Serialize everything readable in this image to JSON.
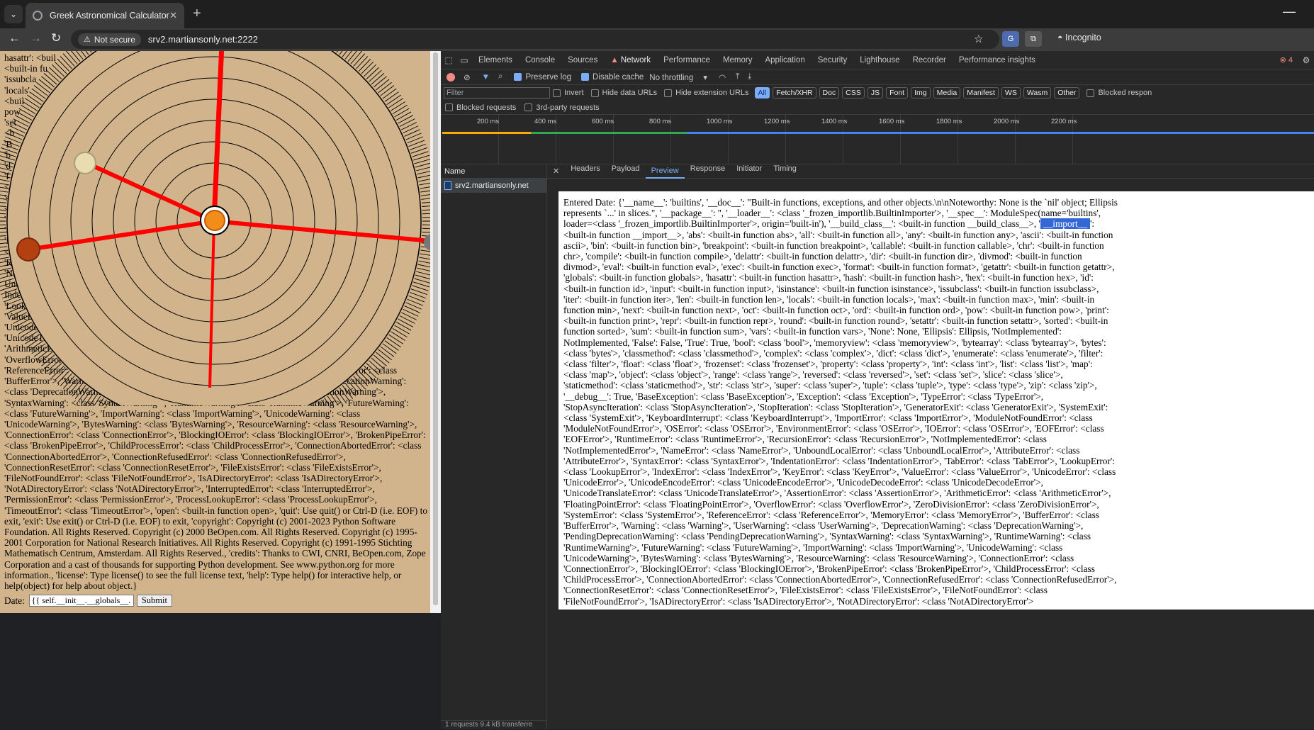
{
  "browser": {
    "tab_title": "Greek Astronomical Calculator",
    "security_label": "Not secure",
    "url": "srv2.martiansonly.net:2222",
    "profile_label": "Incognito"
  },
  "page": {
    "overlay_lines": [
      "hasattr': <buil",
      "<built-in fu",
      "'issubcla",
      "'locals'",
      "<buil",
      "pow",
      "'set",
      "<b",
      "'B",
      "'b",
      "'d",
      "'f",
      "<",
      "'s",
      "<",
      "'Sto",
      "'Sys",
      "'Mod",
      "<class",
      "'Runtim",
      "'NotImple",
      "UnboundL",
      "IndentationEr",
      "'LookupError'>,",
      "'ValueError'>, 'Uni",
      "'UnicodeDecodeError",
      "'UnicodeTranslateError'>,",
      "'ArithmeticError'>, 'FloatingPo",
      "'OverflowError'>, 'ZeroDivisionError",
      "'ReferenceError': <class 'ReferenceError'>, 'MemoryError': <class 'MemoryError'>, 'BufferError': <class"
    ],
    "text": "'BufferError'>, 'Warning': <class 'Warning'>, 'UserWarning': <class 'UserWarning'>, 'DeprecationWarning': <class 'DeprecationWarning'>, 'PendingDeprecationWarning': <class 'PendingDeprecationWarning'>, 'SyntaxWarning': <class 'SyntaxWarning'>, 'RuntimeWarning': <class 'RuntimeWarning'>, 'FutureWarning': <class 'FutureWarning'>, 'ImportWarning': <class 'ImportWarning'>, 'UnicodeWarning': <class 'UnicodeWarning'>, 'BytesWarning': <class 'BytesWarning'>, 'ResourceWarning': <class 'ResourceWarning'>, 'ConnectionError': <class 'ConnectionError'>, 'BlockingIOError': <class 'BlockingIOError'>, 'BrokenPipeError': <class 'BrokenPipeError'>, 'ChildProcessError': <class 'ChildProcessError'>, 'ConnectionAbortedError': <class 'ConnectionAbortedError'>, 'ConnectionRefusedError': <class 'ConnectionRefusedError'>, 'ConnectionResetError': <class 'ConnectionResetError'>, 'FileExistsError': <class 'FileExistsError'>, 'FileNotFoundError': <class 'FileNotFoundError'>, 'IsADirectoryError': <class 'IsADirectoryError'>, 'NotADirectoryError': <class 'NotADirectoryError'>, 'InterruptedError': <class 'InterruptedError'>, 'PermissionError': <class 'PermissionError'>, 'ProcessLookupError': <class 'ProcessLookupError'>, 'TimeoutError': <class 'TimeoutError'>, 'open': <built-in function open>, 'quit': Use quit() or Ctrl-D (i.e. EOF) to exit, 'exit': Use exit() or Ctrl-D (i.e. EOF) to exit, 'copyright': Copyright (c) 2001-2023 Python Software Foundation. All Rights Reserved. Copyright (c) 2000 BeOpen.com. All Rights Reserved. Copyright (c) 1995-2001 Corporation for National Research Initiatives. All Rights Reserved. Copyright (c) 1991-1995 Stichting Mathematisch Centrum, Amsterdam. All Rights Reserved., 'credits': Thanks to CWI, CNRI, BeOpen.com, Zope Corporation and a cast of thousands for supporting Python development. See www.python.org for more information., 'license': Type license() to see the full license text, 'help': Type help() for interactive help, or help(object) for help about object.}",
    "date_label": "Date:",
    "date_value": "{{ self.__init__.__globals__.",
    "submit_label": "Submit"
  },
  "devtools": {
    "tabs": [
      "Elements",
      "Console",
      "Sources",
      "Network",
      "Performance",
      "Memory",
      "Application",
      "Security",
      "Lighthouse",
      "Recorder",
      "Performance insights"
    ],
    "error_count": "4",
    "preserve_log": "Preserve log",
    "disable_cache": "Disable cache",
    "throttling": "No throttling",
    "filter_placeholder": "Filter",
    "invert": "Invert",
    "hide_data_urls": "Hide data URLs",
    "hide_ext_urls": "Hide extension URLs",
    "type_filters": [
      "All",
      "Fetch/XHR",
      "Doc",
      "CSS",
      "JS",
      "Font",
      "Img",
      "Media",
      "Manifest",
      "WS",
      "Wasm",
      "Other"
    ],
    "blocked_resp": "Blocked respon",
    "blocked_requests": "Blocked requests",
    "third_party": "3rd-party requests",
    "ticks": [
      "200 ms",
      "400 ms",
      "600 ms",
      "800 ms",
      "1000 ms",
      "1200 ms",
      "1400 ms",
      "1600 ms",
      "1800 ms",
      "2000 ms",
      "2200 ms"
    ],
    "name_header": "Name",
    "request_name": "srv2.martiansonly.net",
    "status": "1 requests   9.4 kB transferre",
    "detail_tabs": [
      "Headers",
      "Payload",
      "Preview",
      "Response",
      "Initiator",
      "Timing"
    ],
    "preview_before": "Entered Date: {'__name__': 'builtins', '__doc__': \"Built-in functions, exceptions, and other objects.\\n\\nNoteworthy: None is the `nil' object; Ellipsis represents `...' in slices.\", '__package__': '', '__loader__': <class '_frozen_importlib.BuiltinImporter'>, '__spec__': ModuleSpec(name='builtins', loader=<class '_frozen_importlib.BuiltinImporter'>, origin='built-in'), '__build_class__': <built-in function __build_class__>, '",
    "preview_highlight": "__import__",
    "preview_after": "': <built-in function __import__>, 'abs': <built-in function abs>, 'all': <built-in function all>, 'any': <built-in function any>, 'ascii': <built-in function ascii>, 'bin': <built-in function bin>, 'breakpoint': <built-in function breakpoint>, 'callable': <built-in function callable>, 'chr': <built-in function chr>, 'compile': <built-in function compile>, 'delattr': <built-in function delattr>, 'dir': <built-in function dir>, 'divmod': <built-in function divmod>, 'eval': <built-in function eval>, 'exec': <built-in function exec>, 'format': <built-in function format>, 'getattr': <built-in function getattr>, 'globals': <built-in function globals>, 'hasattr': <built-in function hasattr>, 'hash': <built-in function hash>, 'hex': <built-in function hex>, 'id': <built-in function id>, 'input': <built-in function input>, 'isinstance': <built-in function isinstance>, 'issubclass': <built-in function issubclass>, 'iter': <built-in function iter>, 'len': <built-in function len>, 'locals': <built-in function locals>, 'max': <built-in function max>, 'min': <built-in function min>, 'next': <built-in function next>, 'oct': <built-in function oct>, 'ord': <built-in function ord>, 'pow': <built-in function pow>, 'print': <built-in function print>, 'repr': <built-in function repr>, 'round': <built-in function round>, 'setattr': <built-in function setattr>, 'sorted': <built-in function sorted>, 'sum': <built-in function sum>, 'vars': <built-in function vars>, 'None': None, 'Ellipsis': Ellipsis, 'NotImplemented': NotImplemented, 'False': False, 'True': True, 'bool': <class 'bool'>, 'memoryview': <class 'memoryview'>, 'bytearray': <class 'bytearray'>, 'bytes': <class 'bytes'>, 'classmethod': <class 'classmethod'>, 'complex': <class 'complex'>, 'dict': <class 'dict'>, 'enumerate': <class 'enumerate'>, 'filter': <class 'filter'>, 'float': <class 'float'>, 'frozenset': <class 'frozenset'>, 'property': <class 'property'>, 'int': <class 'int'>, 'list': <class 'list'>, 'map': <class 'map'>, 'object': <class 'object'>, 'range': <class 'range'>, 'reversed': <class 'reversed'>, 'set': <class 'set'>, 'slice': <class 'slice'>, 'staticmethod': <class 'staticmethod'>, 'str': <class 'str'>, 'super': <class 'super'>, 'tuple': <class 'tuple'>, 'type': <class 'type'>, 'zip': <class 'zip'>, '__debug__': True, 'BaseException': <class 'BaseException'>, 'Exception': <class 'Exception'>, 'TypeError': <class 'TypeError'>, 'StopAsyncIteration': <class 'StopAsyncIteration'>, 'StopIteration': <class 'StopIteration'>, 'GeneratorExit': <class 'GeneratorExit'>, 'SystemExit': <class 'SystemExit'>, 'KeyboardInterrupt': <class 'KeyboardInterrupt'>, 'ImportError': <class 'ImportError'>, 'ModuleNotFoundError': <class 'ModuleNotFoundError'>, 'OSError': <class 'OSError'>, 'EnvironmentError': <class 'OSError'>, 'IOError': <class 'OSError'>, 'EOFError': <class 'EOFError'>, 'RuntimeError': <class 'RuntimeError'>, 'RecursionError': <class 'RecursionError'>, 'NotImplementedError': <class 'NotImplementedError'>, 'NameError': <class 'NameError'>, 'UnboundLocalError': <class 'UnboundLocalError'>, 'AttributeError': <class 'AttributeError'>, 'SyntaxError': <class 'SyntaxError'>, 'IndentationError': <class 'IndentationError'>, 'TabError': <class 'TabError'>, 'LookupError': <class 'LookupError'>, 'IndexError': <class 'IndexError'>, 'KeyError': <class 'KeyError'>, 'ValueError': <class 'ValueError'>, 'UnicodeError': <class 'UnicodeError'>, 'UnicodeEncodeError': <class 'UnicodeEncodeError'>, 'UnicodeDecodeError': <class 'UnicodeDecodeError'>, 'UnicodeTranslateError': <class 'UnicodeTranslateError'>, 'AssertionError': <class 'AssertionError'>, 'ArithmeticError': <class 'ArithmeticError'>, 'FloatingPointError': <class 'FloatingPointError'>, 'OverflowError': <class 'OverflowError'>, 'ZeroDivisionError': <class 'ZeroDivisionError'>, 'SystemError': <class 'SystemError'>, 'ReferenceError': <class 'ReferenceError'>, 'MemoryError': <class 'MemoryError'>, 'BufferError': <class 'BufferError'>, 'Warning': <class 'Warning'>, 'UserWarning': <class 'UserWarning'>, 'DeprecationWarning': <class 'DeprecationWarning'>, 'PendingDeprecationWarning': <class 'PendingDeprecationWarning'>, 'SyntaxWarning': <class 'SyntaxWarning'>, 'RuntimeWarning': <class 'RuntimeWarning'>, 'FutureWarning': <class 'FutureWarning'>, 'ImportWarning': <class 'ImportWarning'>, 'UnicodeWarning': <class 'UnicodeWarning'>, 'BytesWarning': <class 'BytesWarning'>, 'ResourceWarning': <class 'ResourceWarning'>, 'ConnectionError': <class 'ConnectionError'>, 'BlockingIOError': <class 'BlockingIOError'>, 'BrokenPipeError': <class 'BrokenPipeError'>, 'ChildProcessError': <class 'ChildProcessError'>, 'ConnectionAbortedError': <class 'ConnectionAbortedError'>, 'ConnectionRefusedError': <class 'ConnectionRefusedError'>, 'ConnectionResetError': <class 'ConnectionResetError'>, 'FileExistsError': <class 'FileExistsError'>, 'FileNotFoundError': <class 'FileNotFoundError'>, 'IsADirectoryError': <class 'IsADirectoryError'>, 'NotADirectoryError': <class 'NotADirectoryError'>"
  },
  "colors": {
    "page_bg": "#d2b48c",
    "spokes": "#ff0000",
    "devtools_bg": "#282828",
    "accent": "#7cacf8"
  }
}
